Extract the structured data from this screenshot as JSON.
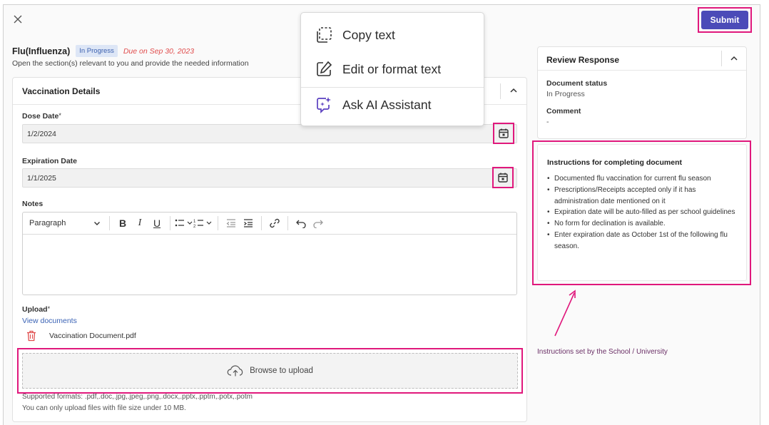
{
  "header": {
    "submit_label": "Submit"
  },
  "document": {
    "title": "Flu(Influenza)",
    "status_badge": "In Progress",
    "due": "Due on Sep 30, 2023",
    "subtitle": "Open the section(s) relevant to you and provide the needed information"
  },
  "vaccination": {
    "section_title": "Vaccination Details",
    "dose_date_label": "Dose Date",
    "dose_date_required": "*",
    "dose_date_value": "1/2/2024",
    "expiration_label": "Expiration Date",
    "expiration_value": "1/1/2025",
    "notes_label": "Notes",
    "paragraph_style": "Paragraph",
    "upload_label": "Upload",
    "upload_required": "*",
    "view_documents": "View documents",
    "uploaded_file": "Vaccination Document.pdf",
    "browse_label": "Browse to upload",
    "supported_formats": "Supported formats: .pdf,.doc,.jpg,.jpeg,.png,.docx,.pptx,.pptm,.potx,.potm",
    "size_limit": "You can only upload files with file size under 10 MB."
  },
  "review": {
    "title": "Review Response",
    "status_label": "Document status",
    "status_value": "In Progress",
    "comment_label": "Comment",
    "comment_value": "-"
  },
  "instructions": {
    "title": "Instructions for completing document",
    "items": [
      "Documented flu vaccination for current flu season",
      "Prescriptions/Receipts accepted only if it has administration date mentioned on it",
      "Expiration date will be auto-filled as per school guidelines",
      "No form for declination is available.",
      "Enter expiration date as October 1st of the following flu season."
    ]
  },
  "annotation": "Instructions set by the School / University",
  "context_menu": {
    "items": [
      {
        "label": "Copy text",
        "icon": "copy-text-icon"
      },
      {
        "label": "Edit or format text",
        "icon": "edit-icon"
      },
      {
        "label": "Ask AI Assistant",
        "icon": "ai-assistant-icon"
      }
    ]
  },
  "colors": {
    "accent": "#4b4bb8",
    "highlight": "#e0187c",
    "due": "#e04c4c",
    "link": "#3b63b5",
    "annotation": "#6a2f66"
  }
}
